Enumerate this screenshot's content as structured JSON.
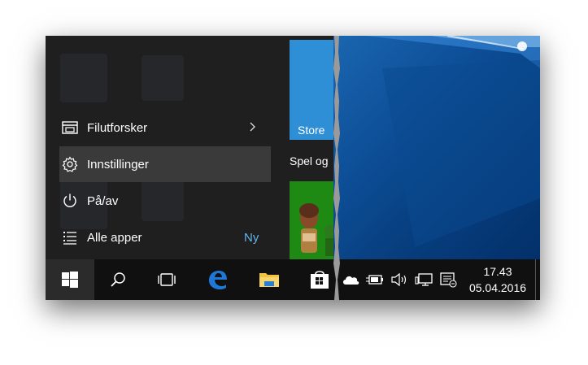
{
  "start_menu": {
    "items": [
      {
        "label": "Filutforsker",
        "icon": "folder-explorer-icon",
        "has_submenu": true
      },
      {
        "label": "Innstillinger",
        "icon": "gear-icon",
        "has_submenu": false
      },
      {
        "label": "På/av",
        "icon": "power-icon",
        "has_submenu": false
      },
      {
        "label": "Alle apper",
        "icon": "all-apps-list-icon",
        "has_submenu": false
      }
    ],
    "new_badge": "Ny",
    "tiles": {
      "store_label": "Store",
      "group_label": "Spel og"
    }
  },
  "taskbar": {
    "apps": [
      "windows-start-icon",
      "search-icon",
      "task-view-icon",
      "edge-icon",
      "file-explorer-icon",
      "store-icon"
    ],
    "tray": [
      "onedrive-cloud-icon",
      "battery-charging-icon",
      "volume-icon",
      "network-icon",
      "action-center-icon"
    ],
    "clock": {
      "time": "17.43",
      "date": "05.04.2016"
    }
  },
  "colors": {
    "accent_blue": "#2e8ed6",
    "link_blue": "#62b4ef",
    "xbox_green": "#1f8a13",
    "menu_bg": "#1f1f1f",
    "taskbar_bg": "#101010",
    "edge_blue": "#1e78d7",
    "folder_yellow": "#f5c342"
  }
}
